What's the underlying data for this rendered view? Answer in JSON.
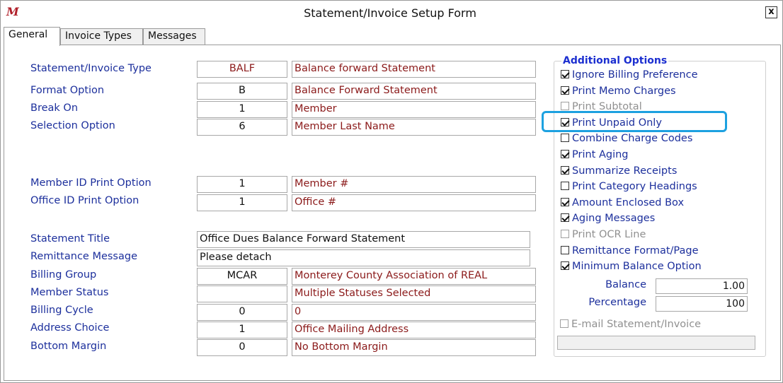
{
  "window": {
    "title": "Statement/Invoice Setup Form",
    "close_label": "x",
    "logo": "M"
  },
  "tabs": [
    {
      "label": "General"
    },
    {
      "label": "Invoice Types"
    },
    {
      "label": "Messages"
    }
  ],
  "fields": {
    "statement_type": {
      "label": "Statement/Invoice Type",
      "code": "BALF",
      "desc": "Balance forward Statement"
    },
    "format_option": {
      "label": "Format Option",
      "code": "B",
      "desc": "Balance Forward Statement"
    },
    "break_on": {
      "label": "Break On",
      "code": "1",
      "desc": "Member"
    },
    "selection_option": {
      "label": "Selection Option",
      "code": "6",
      "desc": "Member Last Name"
    },
    "member_id_print": {
      "label": "Member ID Print Option",
      "code": "1",
      "desc": "Member #"
    },
    "office_id_print": {
      "label": "Office ID Print Option",
      "code": "1",
      "desc": "Office #"
    },
    "statement_title": {
      "label": "Statement Title",
      "value": "Office Dues Balance Forward Statement"
    },
    "remittance_message": {
      "label": "Remittance Message",
      "value": "Please detach"
    },
    "billing_group": {
      "label": "Billing Group",
      "code": "MCAR",
      "desc": "Monterey County Association of REAL"
    },
    "member_status": {
      "label": "Member Status",
      "code": "",
      "desc": "Multiple Statuses Selected"
    },
    "billing_cycle": {
      "label": "Billing Cycle",
      "code": "0",
      "desc": "0"
    },
    "address_choice": {
      "label": "Address Choice",
      "code": "1",
      "desc": "Office Mailing Address"
    },
    "bottom_margin": {
      "label": "Bottom Margin",
      "code": "0",
      "desc": "No Bottom Margin"
    }
  },
  "options": {
    "title": "Additional Options",
    "items": [
      {
        "label": "Ignore Billing Preference",
        "checked": true,
        "enabled": true
      },
      {
        "label": "Print Memo Charges",
        "checked": true,
        "enabled": true
      },
      {
        "label": "Print Subtotal",
        "checked": false,
        "enabled": false
      },
      {
        "label": "Print Unpaid Only",
        "checked": true,
        "enabled": true
      },
      {
        "label": "Combine Charge Codes",
        "checked": false,
        "enabled": true
      },
      {
        "label": "Print Aging",
        "checked": true,
        "enabled": true
      },
      {
        "label": "Summarize Receipts",
        "checked": true,
        "enabled": true
      },
      {
        "label": "Print Category Headings",
        "checked": false,
        "enabled": true
      },
      {
        "label": "Amount Enclosed Box",
        "checked": true,
        "enabled": true
      },
      {
        "label": "Aging Messages",
        "checked": true,
        "enabled": true
      },
      {
        "label": "Print OCR Line",
        "checked": false,
        "enabled": false
      },
      {
        "label": "Remittance Format/Page",
        "checked": false,
        "enabled": true
      },
      {
        "label": "Minimum Balance Option",
        "checked": true,
        "enabled": true
      }
    ],
    "balance": {
      "label": "Balance",
      "value": "1.00"
    },
    "percentage": {
      "label": "Percentage",
      "value": "100"
    },
    "email": {
      "label": "E-mail Statement/Invoice",
      "checked": false,
      "enabled": false
    }
  },
  "colors": {
    "label": "#1c2f9c",
    "description": "#8b1a1a",
    "highlight": "#1da1e0"
  }
}
